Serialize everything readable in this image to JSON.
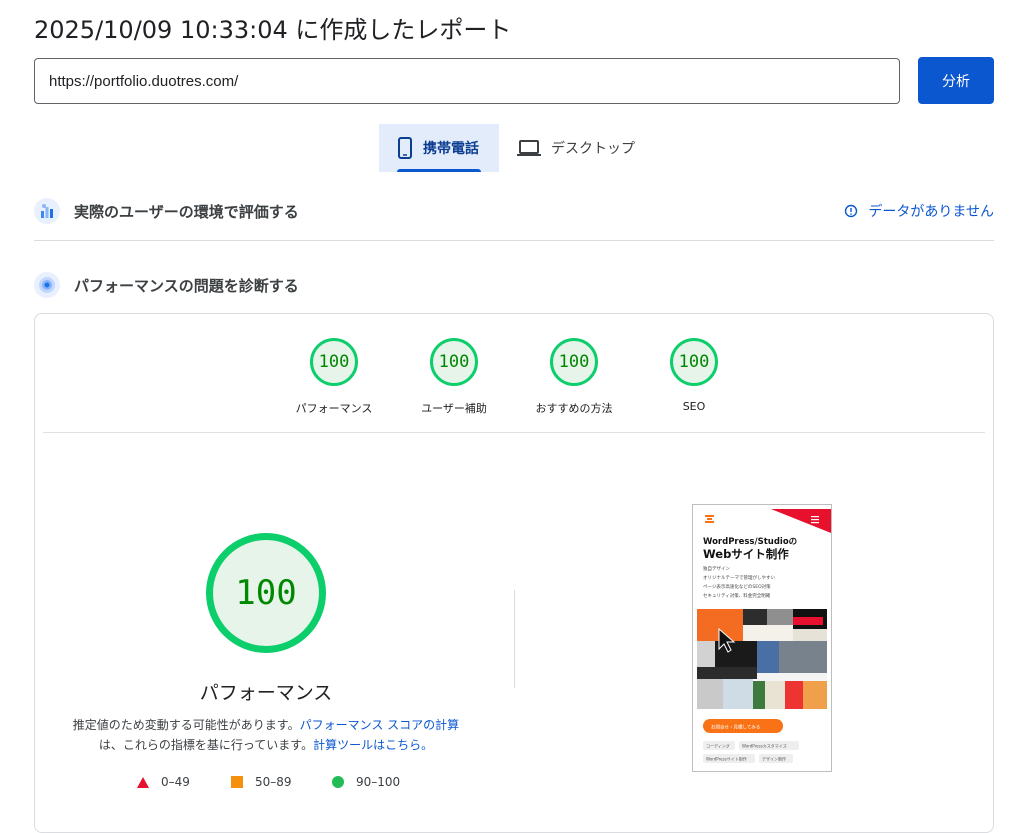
{
  "page": {
    "title": "2025/10/09 10:33:04 に作成したレポート",
    "url_value": "https://portfolio.duotres.com/",
    "analyze_label": "分析"
  },
  "tabs": [
    {
      "label": "携帯電話",
      "icon": "smartphone-icon",
      "active": true
    },
    {
      "label": "デスクトップ",
      "icon": "laptop-icon",
      "active": false
    }
  ],
  "field_data": {
    "heading": "実際のユーザーの環境で評価する",
    "status": "データがありません",
    "icon": "crux-chart-icon",
    "status_icon": "info-icon"
  },
  "diagnostics": {
    "heading": "パフォーマンスの問題を診断する",
    "icon": "lighthouse-icon"
  },
  "scores": [
    {
      "value": "100",
      "label": "パフォーマンス"
    },
    {
      "value": "100",
      "label": "ユーザー補助"
    },
    {
      "value": "100",
      "label": "おすすめの方法"
    },
    {
      "value": "100",
      "label": "SEO"
    }
  ],
  "performance": {
    "score": "100",
    "label": "パフォーマンス",
    "desc_prefix": "推定値のため変動する可能性があります。",
    "link1": "パフォーマンス スコアの計算",
    "desc_mid": "は、これらの指標を基に行っています。",
    "link2": "計算ツールはこちら。"
  },
  "legend": [
    {
      "range": "0–49",
      "color": "#e8112d",
      "shape": "triangle"
    },
    {
      "range": "50–89",
      "color": "#f4900c",
      "shape": "square"
    },
    {
      "range": "90–100",
      "color": "#22bb55",
      "shape": "circle"
    }
  ],
  "screenshot": {
    "headline_1": "WordPress/Studioの",
    "headline_2": "Webサイト制作",
    "lines": [
      "独自デザイン",
      "オリジナルテーマで管理がしやすい",
      "ページ表示高速化などのSEO対策",
      "セキュリティ対策、料金完全明確"
    ],
    "cta": "お問合せ・見積してみる",
    "tags": [
      "コーディング",
      "WordPressカスタマイズ",
      "WordPressサイト制作",
      "デザイン制作"
    ]
  },
  "colors": {
    "accent": "#0b57d0",
    "pass": "#0cce6b",
    "pass_text": "#008800",
    "pass_bg": "#e6f4ea"
  }
}
